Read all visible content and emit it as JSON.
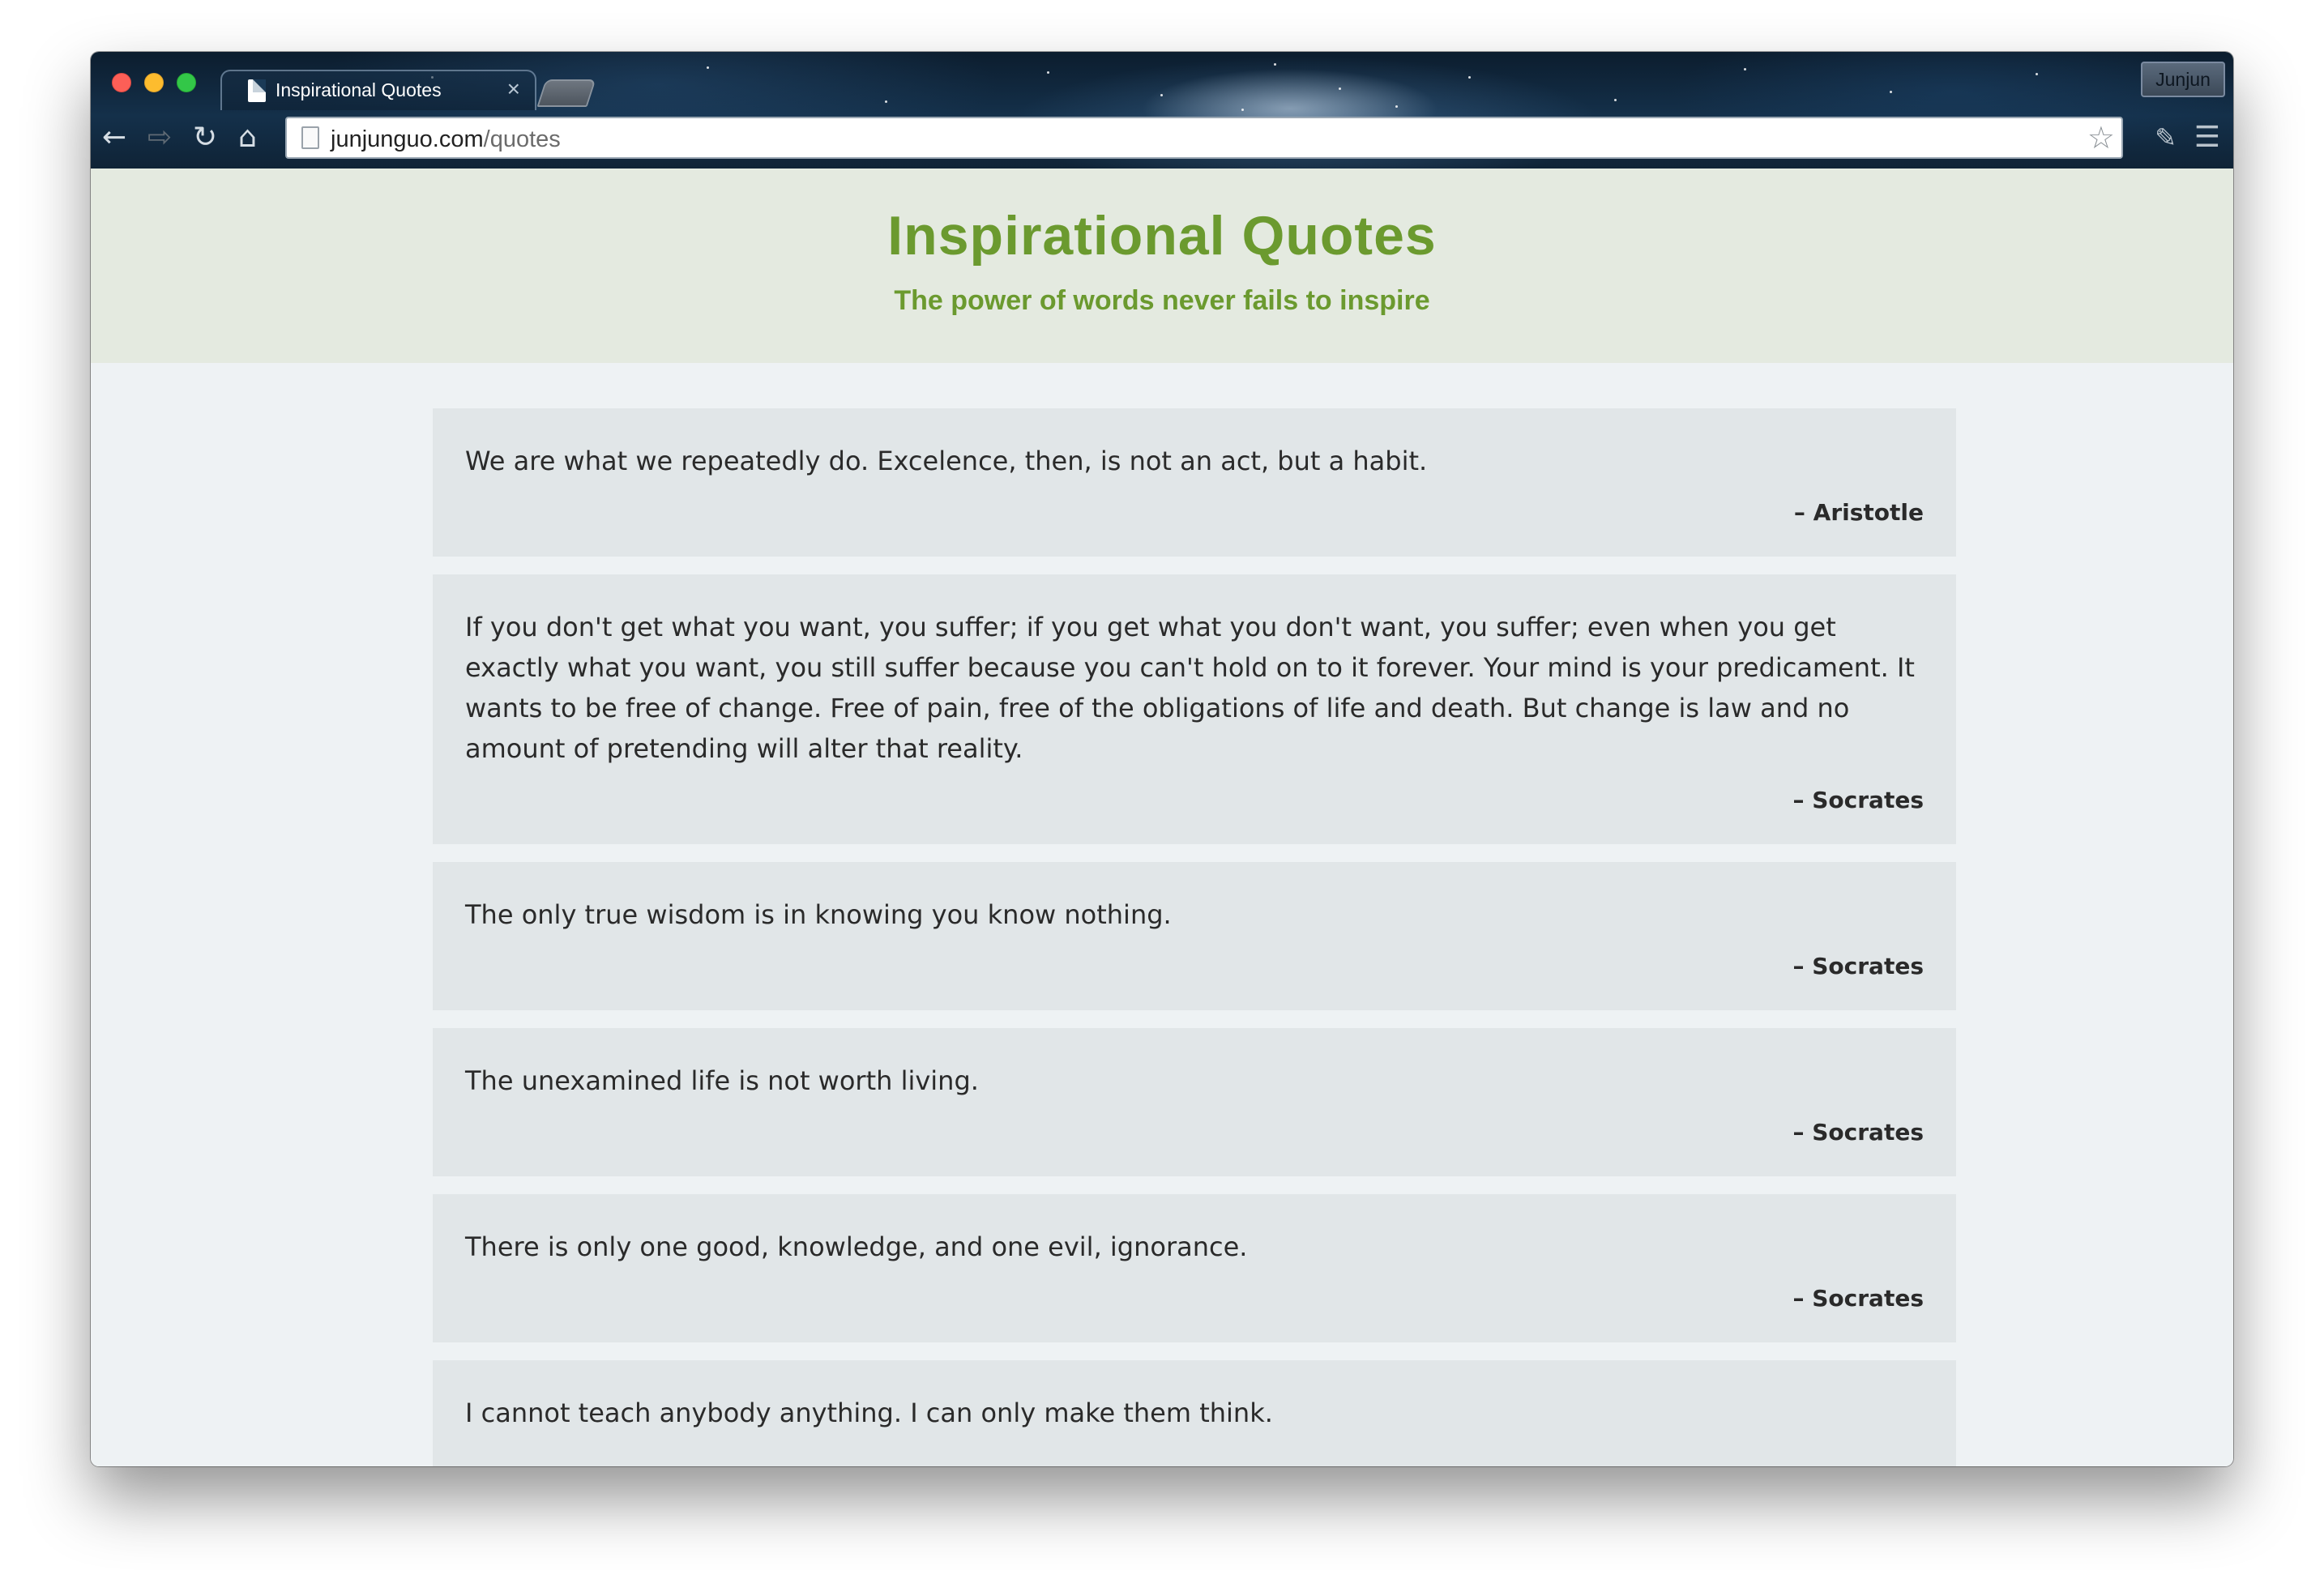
{
  "browser": {
    "tab_title": "Inspirational Quotes",
    "tab_close_glyph": "×",
    "profile_name": "Junjun",
    "url_host": "junjunguo.com",
    "url_path": "/quotes",
    "icons": {
      "back": "←",
      "forward": "⇨",
      "reload": "↻",
      "home": "⌂",
      "bookmark": "☆",
      "extension": "✎",
      "menu": "☰"
    }
  },
  "header": {
    "title": "Inspirational Quotes",
    "subtitle": "The power of words never fails to inspire"
  },
  "quotes": [
    {
      "text": "We are what we repeatedly do. Excelence, then, is not an act, but a habit.",
      "author": "– Aristotle"
    },
    {
      "text": "If you don't get what you want, you suffer; if you get what you don't want, you suffer; even when you get exactly what you want, you still suffer because you can't hold on to it forever. Your mind is your predicament. It wants to be free of change. Free of pain, free of the obligations of life and death. But change is law and no amount of pretending will alter that reality.",
      "author": "– Socrates"
    },
    {
      "text": "The only true wisdom is in knowing you know nothing.",
      "author": "– Socrates"
    },
    {
      "text": "The unexamined life is not worth living.",
      "author": "– Socrates"
    },
    {
      "text": "There is only one good, knowledge, and one evil, ignorance.",
      "author": "– Socrates"
    },
    {
      "text": "I cannot teach anybody anything. I can only make them think.",
      "author": ""
    }
  ],
  "colors": {
    "accent_green": "#6b9a2f",
    "header_bg": "#e4eae0",
    "page_bg": "#eef2f4",
    "card_bg": "#e1e6e8"
  }
}
